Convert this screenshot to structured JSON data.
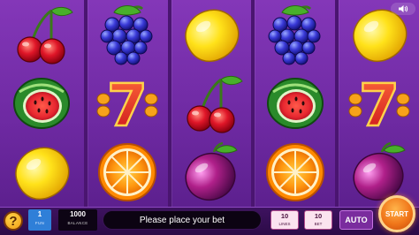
{
  "reels": [
    [
      "cherry",
      "watermelon",
      "lemon"
    ],
    [
      "grapes",
      "seven",
      "orange"
    ],
    [
      "lemon",
      "cherry",
      "plum"
    ],
    [
      "grapes",
      "watermelon",
      "orange"
    ],
    [
      "lemon",
      "seven",
      "plum"
    ]
  ],
  "symbol_labels": {
    "seven": "7"
  },
  "bottom_bar": {
    "help_label": "?",
    "fun": {
      "value": "1",
      "label": "FUN"
    },
    "balance": {
      "value": "1000",
      "label": "BALANCE"
    },
    "message": "Please place your bet",
    "lines": {
      "value": "10",
      "label": "LINES"
    },
    "bet": {
      "value": "10",
      "label": "BET"
    },
    "auto_label": "AUTO",
    "start_label": "START"
  },
  "icons": {
    "sound": "speaker-icon",
    "help": "question-icon"
  },
  "colors": {
    "background": "#6a269f",
    "start_button": "#f0761a",
    "fun_box": "#2f7fd8",
    "pill": "#fbe3ef"
  }
}
